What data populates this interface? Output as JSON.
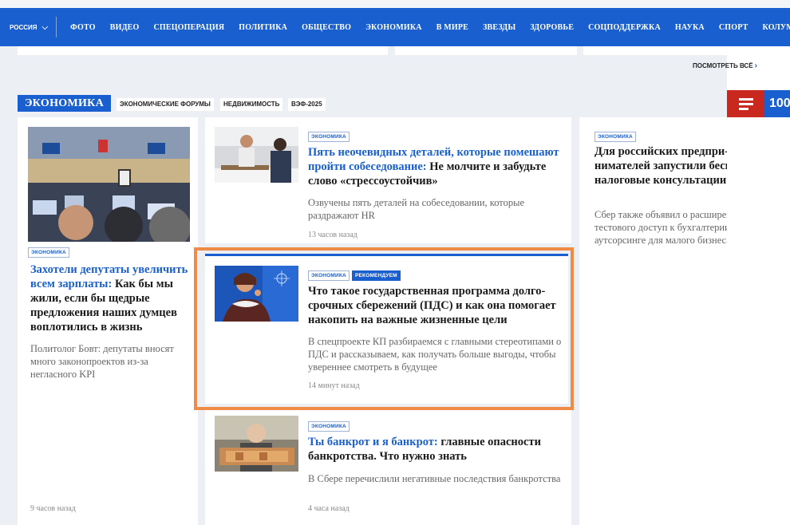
{
  "nav": {
    "region": "РОССИЯ",
    "items": [
      "ФОТО",
      "ВИДЕО",
      "СПЕЦОПЕРАЦИЯ",
      "ПОЛИТИКА",
      "ОБЩЕСТВО",
      "ЭКОНОМИКА",
      "В МИРЕ",
      "ЗВЕЗДЫ",
      "ЗДОРОВЬЕ",
      "СОЦПОДДЕРЖКА",
      "НАУКА",
      "СПОРТ",
      "КОЛУМНИСТЫ"
    ]
  },
  "see_all": "ПОСМОТРЕТЬ ВСЁ",
  "side_logo": "100",
  "section": {
    "title": "ЭКОНОМИКА",
    "tags": [
      "ЭКОНОМИЧЕСКИЕ ФОРУМЫ",
      "НЕДВИЖИМОСТЬ",
      "ВЭФ-2025"
    ]
  },
  "articles": {
    "left": {
      "badge": "ЭКОНОМИКА",
      "headline_link": "Захотели депутаты увели­чить всем зарплаты:",
      "headline_rest": " Как бы мы жили, если бы щедрые предложения наших дум­цев воплотились в жизнь",
      "lead": "Политолог Бовт: депутаты вно­сят много законопроектов из-за негласного KPI",
      "time": "9 часов назад"
    },
    "mid1": {
      "badge": "ЭКОНОМИКА",
      "headline_link": "Пять неочевидных деталей, которые поме­шают пройти собеседование:",
      "headline_rest": " Не молчите и за­будьте слово «стрессоустойчив»",
      "lead": "Озвучены пять деталей на собеседовании, которые раздражают HR",
      "time": "13 часов назад"
    },
    "mid2": {
      "badge": "ЭКОНОМИКА",
      "badge2": "РЕКОМЕНДУЕМ",
      "headline": "Что такое государственная программа долго­срочных сбережений (ПДС) и как она помо­гает накопить на важные жизненные цели",
      "lead": "В спецпроекте КП разбираемся с главными стерео­типами о ПДС и рассказываем, как получать больше выгоды, чтобы увереннее смотреть в будущее",
      "time": "14 минут назад"
    },
    "mid3": {
      "badge": "ЭКОНОМИКА",
      "headline_link": "Ты банкрот и я банкрот:",
      "headline_rest": " главные опасности банкротства. Что нужно знать",
      "lead": "В Сбере перечислили негативные последствия банкротства",
      "time": "4 часа назад"
    },
    "right": {
      "badge": "ЭКОНОМИКА",
      "headline": "Для российских предпри­нимателей запустили бес­платные налоговые консультации",
      "lead": "Сбер также объявил о расши­рении тестового доступ к бухгал­терии на аутсорсинге для малого бизнеса"
    }
  },
  "colors": {
    "brand_blue": "#1a5fd0",
    "highlight_orange": "#ef8a47",
    "menu_red": "#c8281e",
    "page_bg": "#eceff4"
  }
}
